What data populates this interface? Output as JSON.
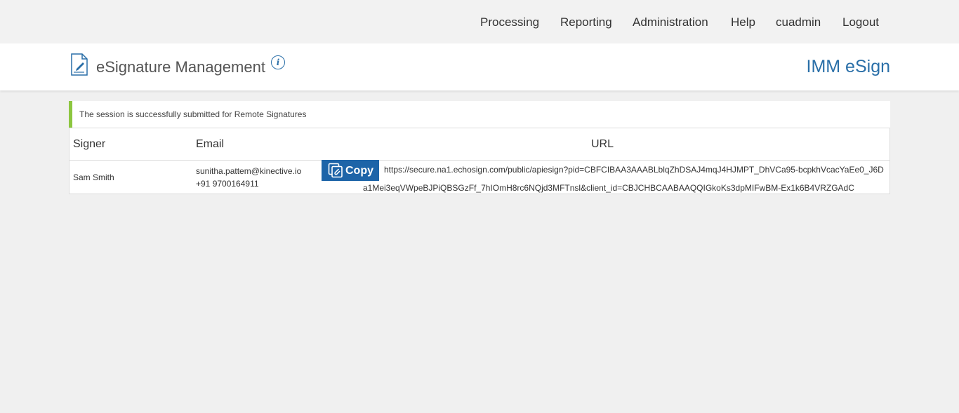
{
  "nav": {
    "items": [
      "Processing",
      "Reporting",
      "Administration",
      "Help",
      "cuadmin",
      "Logout"
    ]
  },
  "header": {
    "title": "eSignature Management",
    "info_icon": "i",
    "brand": "IMM eSign",
    "brand_color": "#2a6fa8"
  },
  "alert": {
    "message": "The session is successfully submitted for Remote Signatures",
    "accent_color": "#8cc63f"
  },
  "table": {
    "columns": [
      "Signer",
      "Email",
      "URL"
    ],
    "rows": [
      {
        "signer": "Sam Smith",
        "email": "sunitha.pattem@kinective.io",
        "phone": "+91 9700164911",
        "copy_label": "Copy",
        "url_line1": "https://secure.na1.echosign.com/public/apiesign?pid=CBFCIBAA3AAABLblqZhDSAJ4mqJ4HJMPT_DhVCa95-bcpkhVcacYaEe0_J6D",
        "url_line2": "a1Mei3eqVWpeBJPiQBSGzFf_7hIOmH8rc6NQjd3MFTnsl&client_id=CBJCHBCAABAAQQIGkoKs3dpMIFwBM-Ex1k6B4VRZGAdC"
      }
    ]
  },
  "icons": [
    "document-signature-icon",
    "info-icon",
    "copy-icon"
  ]
}
